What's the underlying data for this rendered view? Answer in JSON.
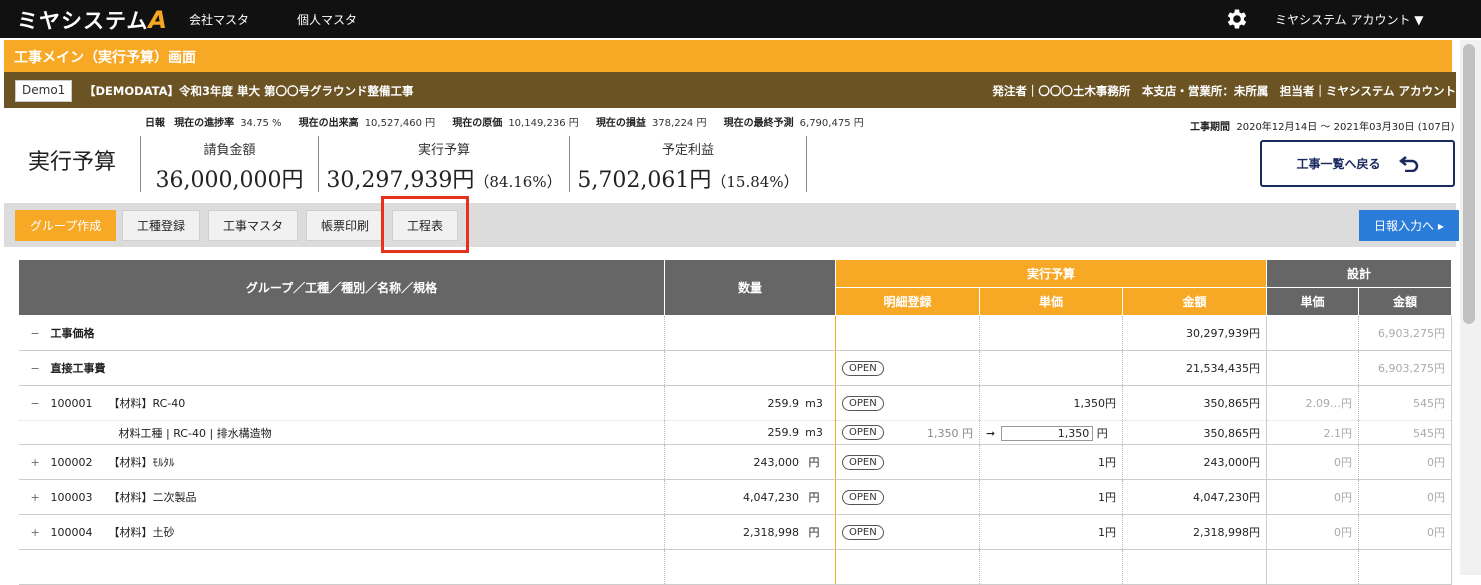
{
  "header": {
    "logo_text": "ミヤシステム",
    "logo_mark": "A",
    "nav": [
      "会社マスタ",
      "個人マスタ"
    ],
    "account": "ミヤシステム アカウント ▼"
  },
  "title": "工事メイン（実行予算）画面",
  "project": {
    "demo": "Demo1",
    "name": "【DEMODATA】令和3年度 単大 第〇〇号グラウンド整備工事",
    "right": "発注者｜〇〇〇土木事務所　本支店・営業所：未所属　担当者｜ミヤシステム アカウント"
  },
  "stats": [
    {
      "label": "日報",
      "value": ""
    },
    {
      "label": "現在の進捗率",
      "value": "34.75 %"
    },
    {
      "label": "現在の出来高",
      "value": "10,527,460 円"
    },
    {
      "label": "現在の原価",
      "value": "10,149,236 円"
    },
    {
      "label": "現在の損益",
      "value": "378,224 円"
    },
    {
      "label": "現在の最終予測",
      "value": "6,790,475 円"
    }
  ],
  "period": {
    "label": "工事期間",
    "value": "2020年12月14日 ～ 2021年03月30日 (107日)"
  },
  "page_heading": "実行予算",
  "kpis": [
    {
      "label": "請負金額",
      "value": "36,000,000円",
      "pct": ""
    },
    {
      "label": "実行予算",
      "value": "30,297,939円",
      "pct": "（84.16%）"
    },
    {
      "label": "予定利益",
      "value": "5,702,061円",
      "pct": "（15.84%）"
    }
  ],
  "back_button": "工事一覧へ戻る",
  "toolbar": {
    "group": "グループ作成",
    "kind": "工種登録",
    "master": "工事マスタ",
    "print": "帳票印刷",
    "schedule": "工程表",
    "daily": "日報入力へ ▸"
  },
  "table": {
    "h_name": "グループ／工種／種別／名称／規格",
    "h_qty": "数量",
    "h_budget": "実行予算",
    "h_design": "設計",
    "h_detail": "明細登録",
    "h_unit": "単価",
    "h_amount": "金額",
    "h_dunit": "単価",
    "h_damount": "金額",
    "open": "OPEN",
    "rows": [
      {
        "toggle": "−",
        "code": "",
        "name": "工事価格",
        "qty": "",
        "qunit": "",
        "open": false,
        "dprice": "",
        "unit": "",
        "amount": "30,297,939円",
        "dunit": "",
        "damount": "6,903,275円"
      },
      {
        "toggle": "−",
        "code": "",
        "name": "直接工事費",
        "qty": "",
        "qunit": "",
        "open": true,
        "dprice": "",
        "unit": "",
        "amount": "21,534,435円",
        "dunit": "",
        "damount": "6,903,275円"
      },
      {
        "toggle": "−",
        "code": "100001",
        "name": "【材料】RC-40",
        "qty": "259.9",
        "qunit": "m3",
        "open": true,
        "dprice": "",
        "unit": "1,350円",
        "amount": "350,865円",
        "dunit": "2.09…円",
        "damount": "545円"
      },
      {
        "toggle": "+",
        "code": "100002",
        "name": "【材料】ﾓﾙﾀﾙ",
        "qty": "243,000",
        "qunit": "円",
        "open": true,
        "dprice": "",
        "unit": "1円",
        "amount": "243,000円",
        "dunit": "0円",
        "damount": "0円"
      },
      {
        "toggle": "+",
        "code": "100003",
        "name": "【材料】二次製品",
        "qty": "4,047,230",
        "qunit": "円",
        "open": true,
        "dprice": "",
        "unit": "1円",
        "amount": "4,047,230円",
        "dunit": "0円",
        "damount": "0円"
      },
      {
        "toggle": "+",
        "code": "100004",
        "name": "【材料】土砂",
        "qty": "2,318,998",
        "qunit": "円",
        "open": true,
        "dprice": "",
        "unit": "1円",
        "amount": "2,318,998円",
        "dunit": "0円",
        "damount": "0円"
      }
    ],
    "sub": {
      "name": "材料工種 | RC-40 | 排水構造物",
      "qty": "259.9",
      "qunit": "m3",
      "dprice": "1,350 円",
      "arrow": "➞",
      "unit_input": "1,350",
      "unit_suffix": "円",
      "amount": "350,865円",
      "dunit": "2.1円",
      "damount": "545円"
    }
  }
}
